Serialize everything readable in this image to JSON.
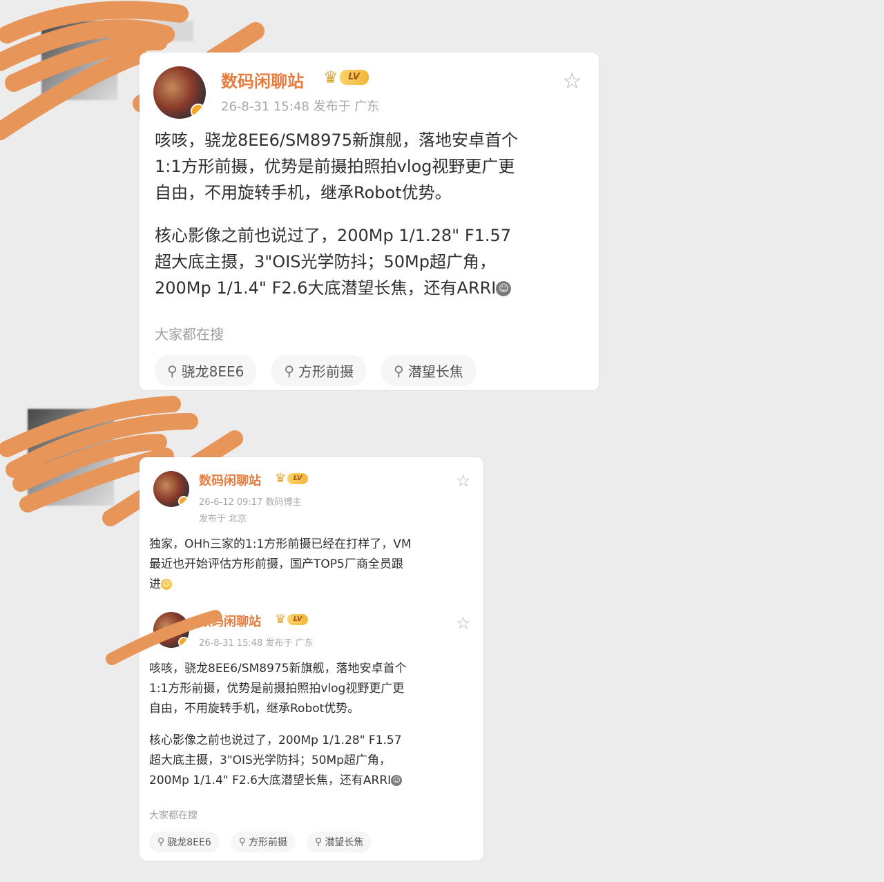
{
  "post_card_1": {
    "username": "数码闲聊站",
    "vip_level": "LV",
    "meta": "26-8-31 15:48  发布于 广东",
    "content_lines_1": [
      "咳咳，骁龙8EE6/SM8975新旗舰，落地安卓首个",
      "1:1方形前摄，优势是前摄拍照拍vlog视野更广更",
      "自由，不用旋转手机，继承Robot优势。"
    ],
    "content_lines_2": [
      "核心影像之前也说过了，200Mp 1/1.28\" F1.57",
      "超大底主摄，3\"OIS光学防抖；50Mp超广角，",
      "200Mp 1/1.4\" F2.6大底潜望长焦，还有ARRI"
    ],
    "hint": "大家都在搜",
    "tags": [
      "骁龙8EE6",
      "方形前摄",
      "潜望长焦"
    ]
  },
  "post_card_2": {
    "post_a": {
      "username": "数码闲聊站",
      "vip_level": "LV",
      "meta_line1": "26-6-12 09:17  数码博主",
      "meta_line2": "发布于 北京",
      "content_lines": [
        "独家，OHh三家的1:1方形前摄已经在打样了，VM",
        "最近也开始评估方形前摄，国产TOP5厂商全员跟",
        "进"
      ]
    },
    "post_b": {
      "username": "数码闲聊站",
      "vip_level": "LV",
      "meta": "26-8-31 15:48  发布于 广东",
      "content_lines_1": [
        "咳咳，骁龙8EE6/SM8975新旗舰，落地安卓首个",
        "1:1方形前摄，优势是前摄拍照拍vlog视野更广更",
        "自由，不用旋转手机，继承Robot优势。"
      ],
      "content_lines_2": [
        "核心影像之前也说过了，200Mp 1/1.28\" F1.57",
        "超大底主摄，3\"OIS光学防抖；50Mp超广角，",
        "200Mp 1/1.4\" F2.6大底潜望长焦，还有ARRI"
      ],
      "hint": "大家都在搜",
      "tags": [
        "骁龙8EE6",
        "方形前摄",
        "潜望长焦"
      ]
    }
  },
  "icons": {
    "star": "star-outline-icon",
    "search": "search-icon",
    "crown": "crown-icon"
  },
  "colors": {
    "background": "#ececec",
    "card": "#ffffff",
    "username": "#e87c3e",
    "redaction": "#e8955a",
    "meta": "#a8a8a8",
    "text": "#2f2f2f"
  }
}
